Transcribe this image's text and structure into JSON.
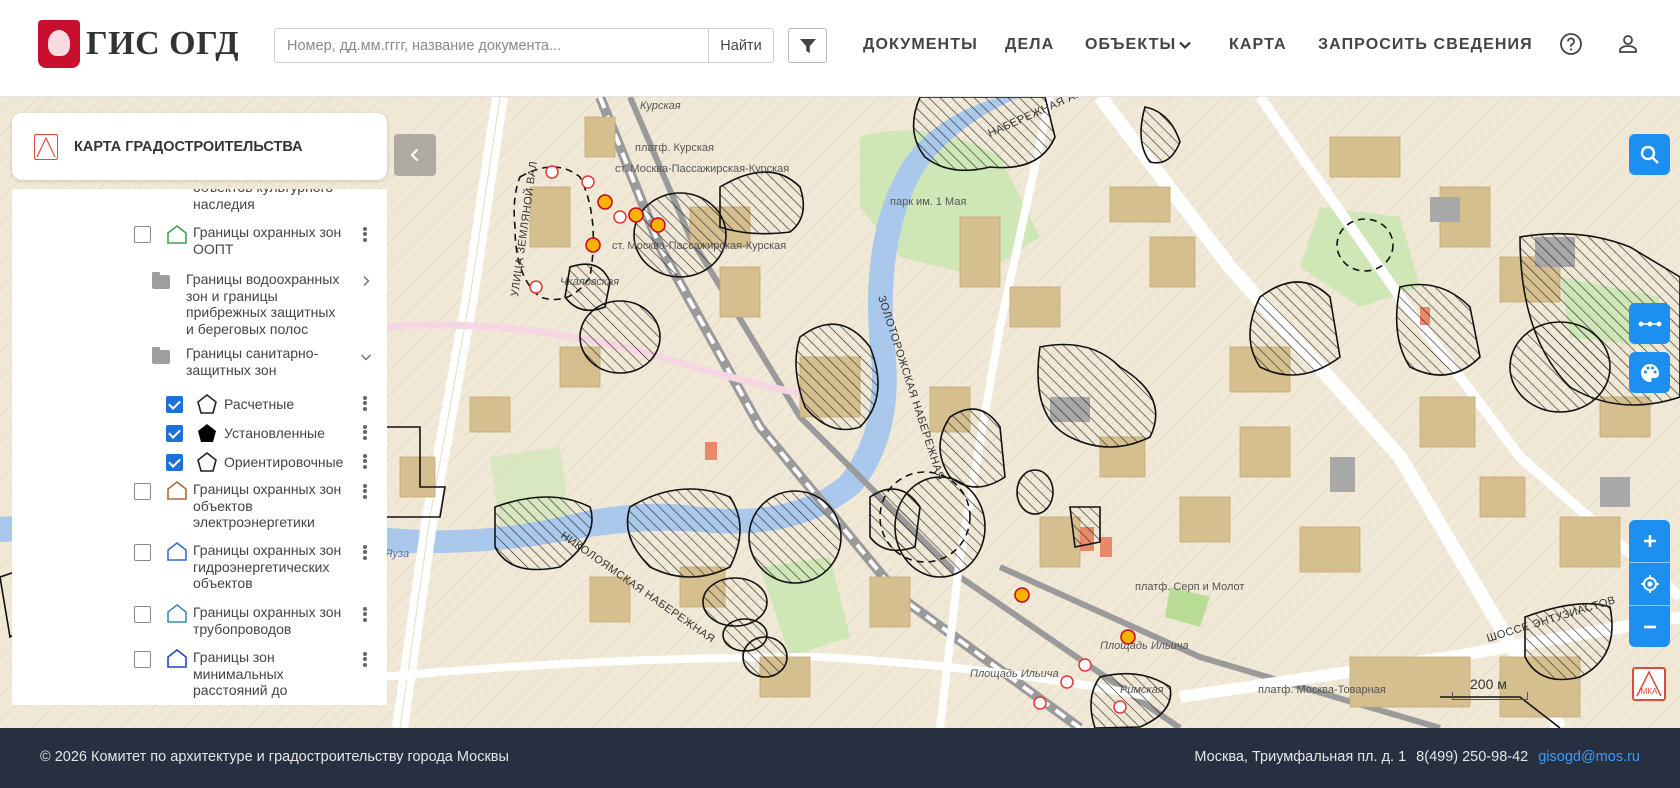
{
  "header": {
    "logo_text": "ГИС ОГД",
    "search_placeholder": "Номер, дд.мм.гггг, название документа...",
    "search_button": "Найти",
    "nav": [
      "ДОКУМЕНТЫ",
      "ДЕЛА",
      "ОБЪЕКТЫ",
      "КАРТА",
      "ЗАПРОСИТЬ СВЕДЕНИЯ"
    ],
    "icons": [
      "filter-icon",
      "chevron-down-icon",
      "help-icon",
      "user-icon"
    ]
  },
  "panel": {
    "title": "КАРТА ГРАДОСТРОИТЕЛЬСТВА",
    "layers": [
      {
        "label": "объектов культурного наследия",
        "checked": false,
        "type": "text-only"
      },
      {
        "label": "Границы охранных зон ООПТ",
        "checked": false,
        "icon_color": "#3fa34d"
      },
      {
        "label": "Границы водоохранных зон и границы прибрежных защитных и береговых полос",
        "type": "folder",
        "expanded": false
      },
      {
        "label": "Границы санитарно-защитных зон",
        "type": "folder",
        "expanded": true
      },
      {
        "label": "Расчетные",
        "checked": true,
        "icon_color": "#222222"
      },
      {
        "label": "Установленные",
        "checked": true,
        "icon_color": "#000000",
        "filled": true
      },
      {
        "label": "Ориентировочные",
        "checked": true,
        "icon_color": "#222222"
      },
      {
        "label": "Границы охранных зон объектов электроэнергетики",
        "checked": false,
        "icon_color": "#b06a3a"
      },
      {
        "label": "Границы охранных зон гидроэнергетических объектов",
        "checked": false,
        "icon_color": "#3a6adb"
      },
      {
        "label": "Границы охранных зон трубопроводов",
        "checked": false,
        "icon_color": "#3a8fb0"
      },
      {
        "label": "Границы зон минимальных расстояний до",
        "checked": false,
        "icon_color": "#2244cc"
      }
    ]
  },
  "map": {
    "street_labels": [
      "УЛИЦА ЗЕМЛЯНОЙ ВАЛ",
      "ЗОЛОТОРОЖСКАЯ НАБЕРЕЖНАЯ",
      "НИКОЛОЯМСКАЯ НАБЕРЕЖНАЯ",
      "НАБЕРЕЖНАЯ АКАДЕМИКА ТУПОЛЕВА",
      "ШОССЕ ЭНТУЗИАСТОВ"
    ],
    "place_labels": [
      "Курская",
      "платф. Курская",
      "ст. Москва-Пассажирская-Курская",
      "ст. Москва-Пассажирская-Курская",
      "Чкаловская",
      "парк им. 1 Мая",
      "платф. Серп и Молот",
      "Площадь Ильича",
      "Площадь Ильича",
      "Римская",
      "платф. Москва-Товарная",
      "Яуза"
    ],
    "scale_label": "200 м",
    "colors": {
      "water": "#a9c8ec",
      "park": "#cfe6b7",
      "building": "#d6bf8f",
      "base": "#f1e9d8",
      "accent": "#1d8ff0"
    }
  },
  "map_controls": [
    "search-icon",
    "measure-icon",
    "palette-icon",
    "zoom-in-icon",
    "locate-icon",
    "zoom-out-icon",
    "mka-logo-icon"
  ],
  "footer": {
    "copyright": "© 2026 Комитет по архитектуре и градостроительству города Москвы",
    "address": "Москва, Триумфальная пл. д. 1",
    "phone": "8(499) 250-98-42",
    "email": "gisogd@mos.ru"
  }
}
